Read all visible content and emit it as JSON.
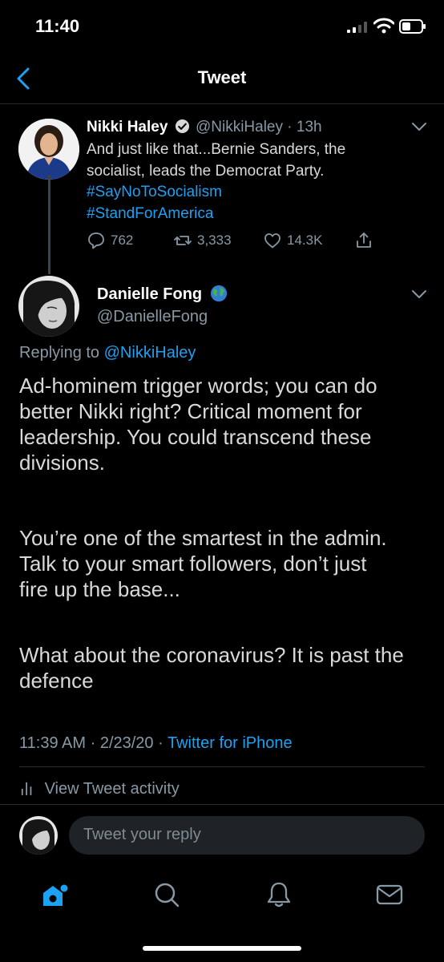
{
  "status_bar": {
    "time": "11:40"
  },
  "nav": {
    "title": "Tweet"
  },
  "parent_tweet": {
    "name": "Nikki Haley",
    "handle": "@NikkiHaley",
    "sep": "·",
    "age": "13h",
    "text": "And just like that...Bernie Sanders, the socialist, leads the Democrat Party.",
    "hashtags": [
      "#SayNoToSocialism",
      "#StandForAmerica"
    ],
    "replies": "762",
    "retweets": "3,333",
    "likes": "14.3K",
    "verified": true
  },
  "main_tweet": {
    "name": "Danielle Fong",
    "handle": "@DanielleFong",
    "replying_prefix": "Replying to",
    "replying_to": "@NikkiHaley",
    "paragraphs": [
      "Ad-hominem trigger words; you can do better Nikki right? Critical moment for leadership. You could transcend these divisions.",
      "You’re one of the smartest in the admin. Talk to your smart followers, don’t just fire up the base...",
      "What about the coronavirus? It is past the defence"
    ],
    "time": "11:39 AM",
    "date": "2/23/20",
    "sep": "·",
    "source": "Twitter for iPhone"
  },
  "activity": {
    "label": "View Tweet activity"
  },
  "reply": {
    "placeholder": "Tweet your reply"
  },
  "colors": {
    "accent": "#1da1f2",
    "muted": "#8899a6",
    "background": "#000000"
  },
  "icons": [
    "back-chevron-icon",
    "verified-badge-icon",
    "globe-emoji",
    "reply-icon",
    "retweet-icon",
    "like-icon",
    "share-icon",
    "activity-bars-icon",
    "home-icon",
    "search-icon",
    "notifications-icon",
    "messages-icon"
  ]
}
